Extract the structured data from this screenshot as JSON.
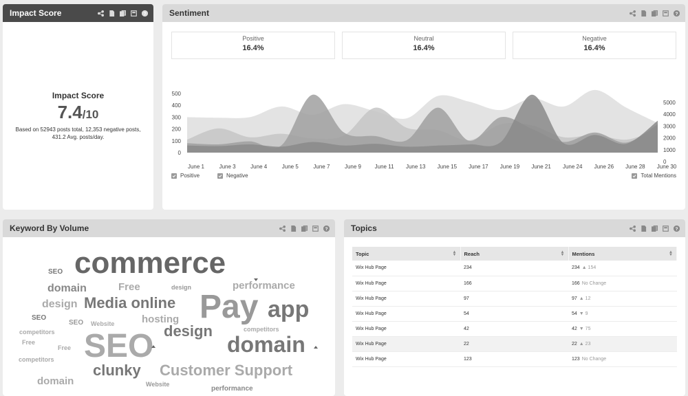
{
  "impact": {
    "title": "Impact Score",
    "label": "Impact Score",
    "score": "7.4",
    "max": "/10",
    "description": "Based on 52943 posts total, 12,353 negative posts, 431.2 Avg. posts/day."
  },
  "sentiment": {
    "title": "Sentiment",
    "kpis": [
      {
        "label": "Positive",
        "value": "16.4%"
      },
      {
        "label": "Neutral",
        "value": "16.4%"
      },
      {
        "label": "Negative",
        "value": "16.4%"
      }
    ],
    "legend": {
      "positive": "Positive",
      "negative": "Negative",
      "total": "Total Mentions"
    }
  },
  "chart_data": {
    "type": "area",
    "title": "",
    "xlabel": "",
    "ylabel": "",
    "ylim": [
      0,
      500
    ],
    "ylim_right": [
      0,
      5000
    ],
    "yticks_left": [
      "500",
      "400",
      "300",
      "200",
      "100",
      "0"
    ],
    "yticks_right": [
      "5000",
      "4000",
      "3000",
      "2000",
      "1000",
      "0"
    ],
    "categories": [
      "June 1",
      "June 3",
      "June 4",
      "June 5",
      "June 7",
      "June 9",
      "June 11",
      "June 13",
      "June 15",
      "June 17",
      "June 19",
      "June 21",
      "June 24",
      "June 26",
      "June 28",
      "June 30"
    ],
    "grid": false,
    "series": [
      {
        "name": "Total Mentions",
        "axis": "right",
        "color": "#e3e3e3",
        "values": [
          3000,
          2950,
          3000,
          3900,
          3200,
          4100,
          3500,
          2900,
          4800,
          4300,
          3600,
          4600,
          3900,
          5300,
          3800,
          2500
        ]
      },
      {
        "name": "Positive",
        "color": "#c6c6c6",
        "values": [
          110,
          205,
          130,
          160,
          120,
          145,
          380,
          210,
          190,
          105,
          240,
          230,
          130,
          150,
          110,
          195
        ]
      },
      {
        "name": "Negative",
        "color": "#a0a0a0",
        "values": [
          80,
          70,
          95,
          60,
          490,
          170,
          140,
          105,
          380,
          100,
          300,
          200,
          90,
          170,
          85,
          240
        ]
      },
      {
        "color": "#8a8a8a",
        "values": [
          60,
          55,
          70,
          50,
          90,
          60,
          75,
          50,
          60,
          70,
          90,
          490,
          80,
          150,
          75,
          270
        ]
      }
    ]
  },
  "keyword": {
    "title": "Keyword By Volume",
    "words": [
      {
        "text": "commerce",
        "size": 44,
        "color": "#666"
      },
      {
        "text": "Pay",
        "size": 48,
        "color": "#999"
      },
      {
        "text": "app",
        "size": 34,
        "color": "#777"
      },
      {
        "text": "SEO",
        "size": 48,
        "color": "#aaa"
      },
      {
        "text": "domain",
        "size": 32,
        "color": "#777"
      },
      {
        "text": "Media online",
        "size": 22,
        "color": "#777"
      },
      {
        "text": "Customer Support",
        "size": 22,
        "color": "#aaa"
      },
      {
        "text": "design",
        "size": 22,
        "color": "#777"
      },
      {
        "text": "clunky",
        "size": 22,
        "color": "#777"
      },
      {
        "text": "domain",
        "size": 16,
        "color": "#888"
      },
      {
        "text": "design",
        "size": 16,
        "color": "#aaa"
      },
      {
        "text": "hosting",
        "size": 15,
        "color": "#aaa"
      },
      {
        "text": "performance",
        "size": 15,
        "color": "#aaa"
      },
      {
        "text": "Free",
        "size": 15,
        "color": "#aaa"
      },
      {
        "text": "domain",
        "size": 15,
        "color": "#aaa"
      },
      {
        "text": "SEO",
        "size": 10,
        "color": "#777"
      },
      {
        "text": "SEO",
        "size": 10,
        "color": "#777"
      },
      {
        "text": "SEO",
        "size": 10,
        "color": "#999"
      },
      {
        "text": "design",
        "size": 9,
        "color": "#999"
      },
      {
        "text": "competitors",
        "size": 9,
        "color": "#aaa"
      },
      {
        "text": "Free",
        "size": 9,
        "color": "#aaa"
      },
      {
        "text": "Free",
        "size": 9,
        "color": "#aaa"
      },
      {
        "text": "competitors",
        "size": 9,
        "color": "#aaa"
      },
      {
        "text": "Website",
        "size": 9,
        "color": "#aaa"
      },
      {
        "text": "competitors",
        "size": 9,
        "color": "#aaa"
      },
      {
        "text": "Website",
        "size": 9,
        "color": "#999"
      },
      {
        "text": "performance",
        "size": 10,
        "color": "#888"
      }
    ]
  },
  "topics": {
    "title": "Topics",
    "headers": [
      "Topic",
      "Reach",
      "Mentions"
    ],
    "rows": [
      {
        "topic": "Wix Hub Page",
        "reach": "234",
        "mentions": "234",
        "change": "▲ 154"
      },
      {
        "topic": "Wix Hub Page",
        "reach": "166",
        "mentions": "166",
        "change": "No Change"
      },
      {
        "topic": "Wix Hub Page",
        "reach": "97",
        "mentions": "97",
        "change": "▲ 12"
      },
      {
        "topic": "Wix Hub Page",
        "reach": "54",
        "mentions": "54",
        "change": "▼ 9"
      },
      {
        "topic": "Wix Hub Page",
        "reach": "42",
        "mentions": "42",
        "change": "▼ 75"
      },
      {
        "topic": "Wix Hub Page",
        "reach": "22",
        "mentions": "22",
        "change": "▲ 23"
      },
      {
        "topic": "Wix Hub Page",
        "reach": "123",
        "mentions": "123",
        "change": "No Change"
      }
    ]
  },
  "icons": [
    "share-icon",
    "document-icon",
    "export-icon",
    "fullscreen-icon",
    "help-icon"
  ]
}
